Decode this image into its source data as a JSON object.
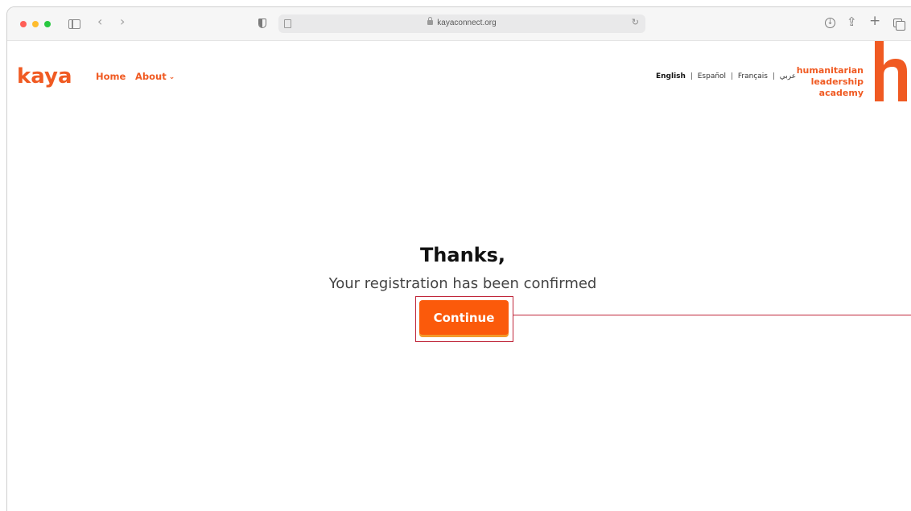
{
  "browser": {
    "url": "kayaconnect.org",
    "icons": [
      "sidebar-icon",
      "back-icon",
      "forward-icon",
      "shield-icon",
      "reader-icon",
      "lock-icon",
      "reload-icon",
      "download-icon",
      "share-icon",
      "new-tab-icon",
      "tabs-overview-icon"
    ],
    "glyphs": {
      "back": "‹",
      "forward": "›",
      "reload": "↻",
      "download": "↓",
      "share": "⇪",
      "new_tab": "+"
    }
  },
  "site": {
    "logo": "kaya",
    "nav": {
      "home": "Home",
      "about": "About",
      "about_chevron": "⌄"
    },
    "languages": [
      {
        "label": "English",
        "active": true
      },
      {
        "label": "Español",
        "active": false
      },
      {
        "label": "Français",
        "active": false
      },
      {
        "label": "عربي",
        "active": false
      }
    ],
    "language_separator": "|",
    "partner_logo": {
      "line1": "humanitarian",
      "line2": "leadership",
      "line3": "academy"
    },
    "colors": {
      "brand": "#f05a22",
      "button": "#fb5a0b",
      "annotation": "#c0263a"
    }
  },
  "main": {
    "heading": "Thanks,",
    "message": "Your registration has been confirmed",
    "continue_label": "Continue"
  }
}
